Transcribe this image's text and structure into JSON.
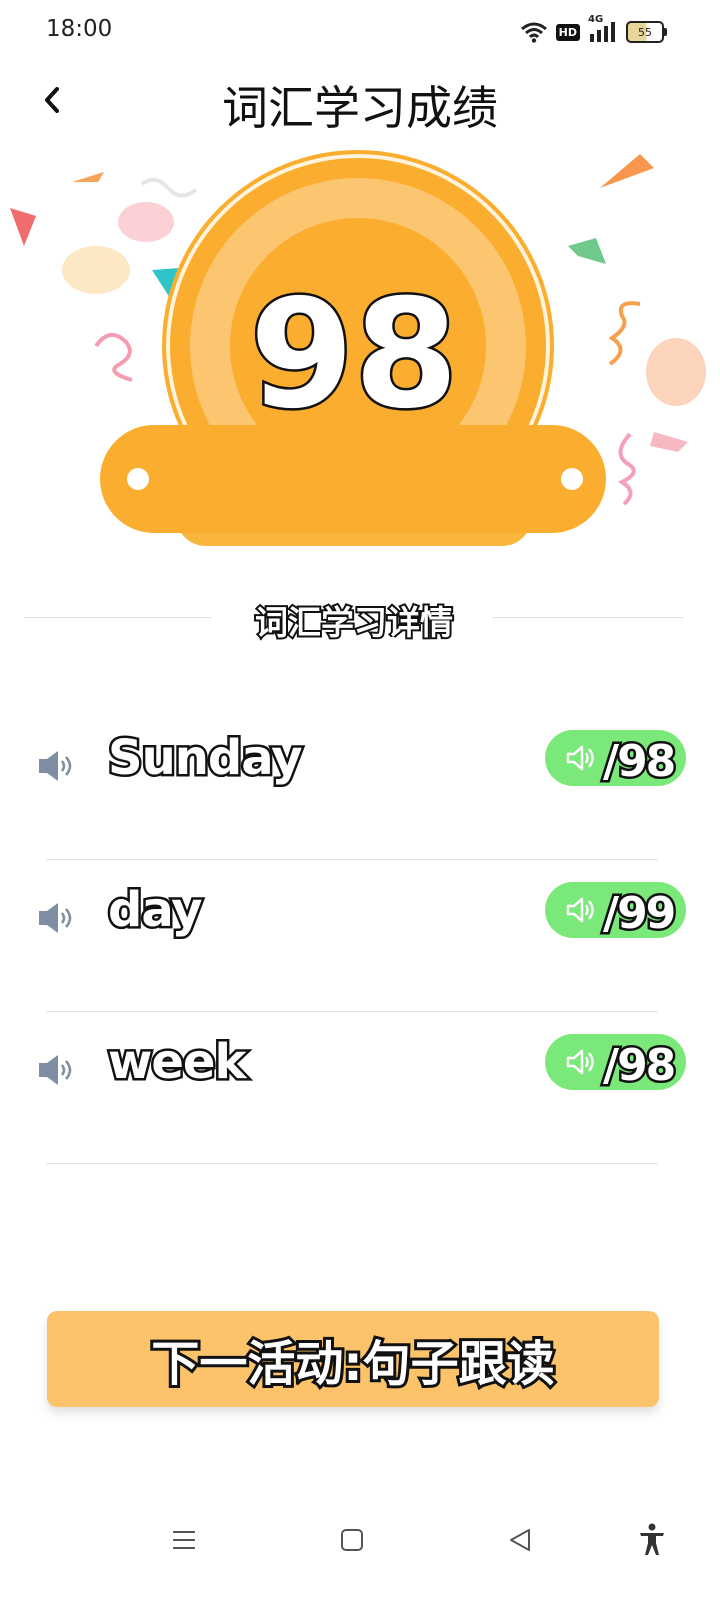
{
  "status_bar": {
    "time": "18:00",
    "hd_label": "HD",
    "network_label": "4G",
    "battery_level": "55",
    "icons": [
      "wifi-icon",
      "hd-icon",
      "signal-4g-icon",
      "battery-icon"
    ]
  },
  "header": {
    "title": "词汇学习成绩",
    "back_icon": "chevron-left-icon"
  },
  "score": {
    "value": "98"
  },
  "details": {
    "section_title": "词汇学习详情",
    "words": [
      {
        "word": "Sunday",
        "score": "/98"
      },
      {
        "word": "day",
        "score": "/99"
      },
      {
        "word": "week",
        "score": "/98"
      }
    ]
  },
  "next_activity": {
    "label": "下一活动:句子跟读"
  },
  "nav_bar": {
    "icons": [
      "menu-icon",
      "home-square-icon",
      "back-triangle-icon",
      "accessibility-icon"
    ]
  },
  "colors": {
    "accent_orange": "#fbad2f",
    "button_orange": "#fcc36b",
    "score_green": "#7be87a",
    "speaker_gray": "#7e8fa3"
  }
}
